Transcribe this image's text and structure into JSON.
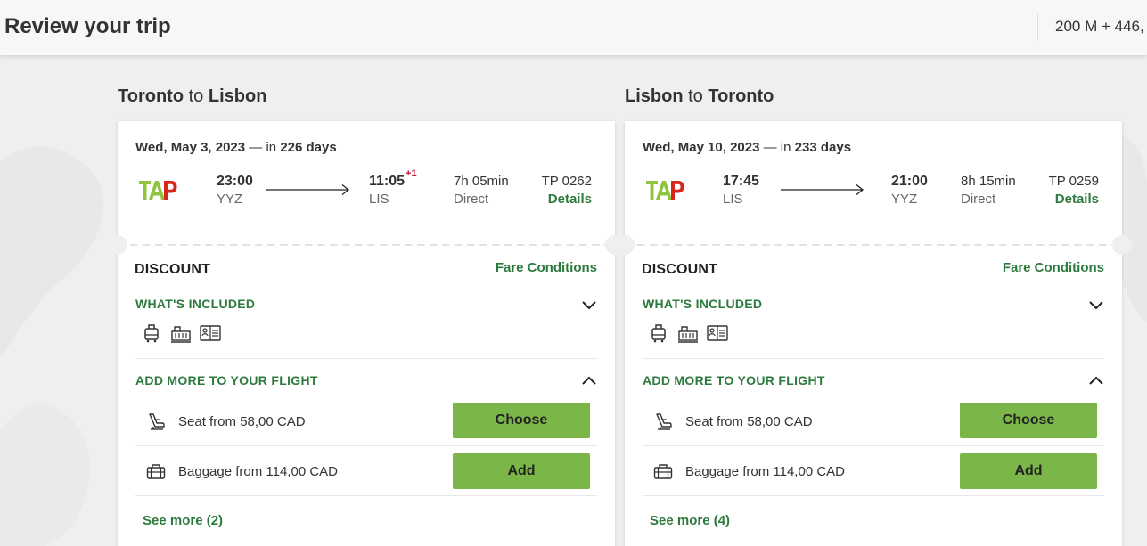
{
  "header": {
    "title": "Review your trip",
    "points": "200 M + 446,"
  },
  "colors": {
    "accent_green": "#2d7a3e",
    "button_green": "#7ab648",
    "plus_day_red": "#c8102e"
  },
  "legs": [
    {
      "origin_city": "Toronto",
      "connector": "to",
      "destination_city": "Lisbon",
      "date": "Wed, May 3, 2023",
      "in_text": "— in",
      "days": "226 days",
      "airline_icon": "tap-logo-icon",
      "departure_time": "23:00",
      "departure_airport": "YYZ",
      "arrival_time": "11:05",
      "arrival_plus": "+1",
      "arrival_airport": "LIS",
      "duration": "7h 05min",
      "stops": "Direct",
      "flight_number": "TP 0262",
      "details_label": "Details",
      "fare_name": "DISCOUNT",
      "fare_conditions_label": "Fare Conditions",
      "included_label": "WHAT'S INCLUDED",
      "included_icons": [
        "cabin-bag-icon",
        "checked-bag-icon",
        "seat-selection-icon"
      ],
      "add_more_label": "ADD MORE TO YOUR FLIGHT",
      "addons": [
        {
          "icon": "seat-icon",
          "label": "Seat from 58,00 CAD",
          "button": "Choose"
        },
        {
          "icon": "baggage-icon",
          "label": "Baggage from 114,00 CAD",
          "button": "Add"
        }
      ],
      "see_more": "See more (2)"
    },
    {
      "origin_city": "Lisbon",
      "connector": "to",
      "destination_city": "Toronto",
      "date": "Wed, May 10, 2023",
      "in_text": "— in",
      "days": "233 days",
      "airline_icon": "tap-logo-icon",
      "departure_time": "17:45",
      "departure_airport": "LIS",
      "arrival_time": "21:00",
      "arrival_plus": "",
      "arrival_airport": "YYZ",
      "duration": "8h 15min",
      "stops": "Direct",
      "flight_number": "TP 0259",
      "details_label": "Details",
      "fare_name": "DISCOUNT",
      "fare_conditions_label": "Fare Conditions",
      "included_label": "WHAT'S INCLUDED",
      "included_icons": [
        "cabin-bag-icon",
        "checked-bag-icon",
        "seat-selection-icon"
      ],
      "add_more_label": "ADD MORE TO YOUR FLIGHT",
      "addons": [
        {
          "icon": "seat-icon",
          "label": "Seat from 58,00 CAD",
          "button": "Choose"
        },
        {
          "icon": "baggage-icon",
          "label": "Baggage from 114,00 CAD",
          "button": "Add"
        }
      ],
      "see_more": "See more (4)"
    }
  ]
}
